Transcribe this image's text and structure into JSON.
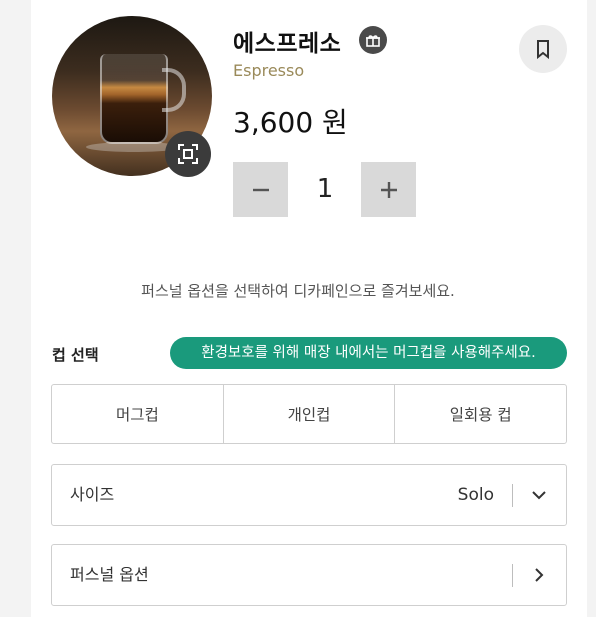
{
  "product": {
    "name": "에스프레소",
    "english_name": "Espresso",
    "price": "3,600 원",
    "quantity": "1",
    "icons": {
      "gift": "gift-icon",
      "bookmark": "bookmark-icon",
      "expand": "expand-icon",
      "minus": "minus-icon",
      "plus": "plus-icon"
    }
  },
  "notice": {
    "personal_option": "퍼스널 옵션을 선택하여 디카페인으로 즐겨보세요."
  },
  "cup_selection": {
    "title": "컵 선택",
    "eco_badge": "환경보호를 위해 매장 내에서는 머그컵을 사용해주세요.",
    "options": [
      "머그컵",
      "개인컵",
      "일회용 컵"
    ]
  },
  "size": {
    "label": "사이즈",
    "value": "Solo",
    "icon": "chevron-down-icon"
  },
  "personal_option": {
    "label": "퍼스널 옵션",
    "icon": "chevron-right-icon"
  },
  "colors": {
    "eco_badge": "#1a9a7c",
    "subname": "#9a8a5a",
    "quantity_button": "#d9d9d9"
  }
}
